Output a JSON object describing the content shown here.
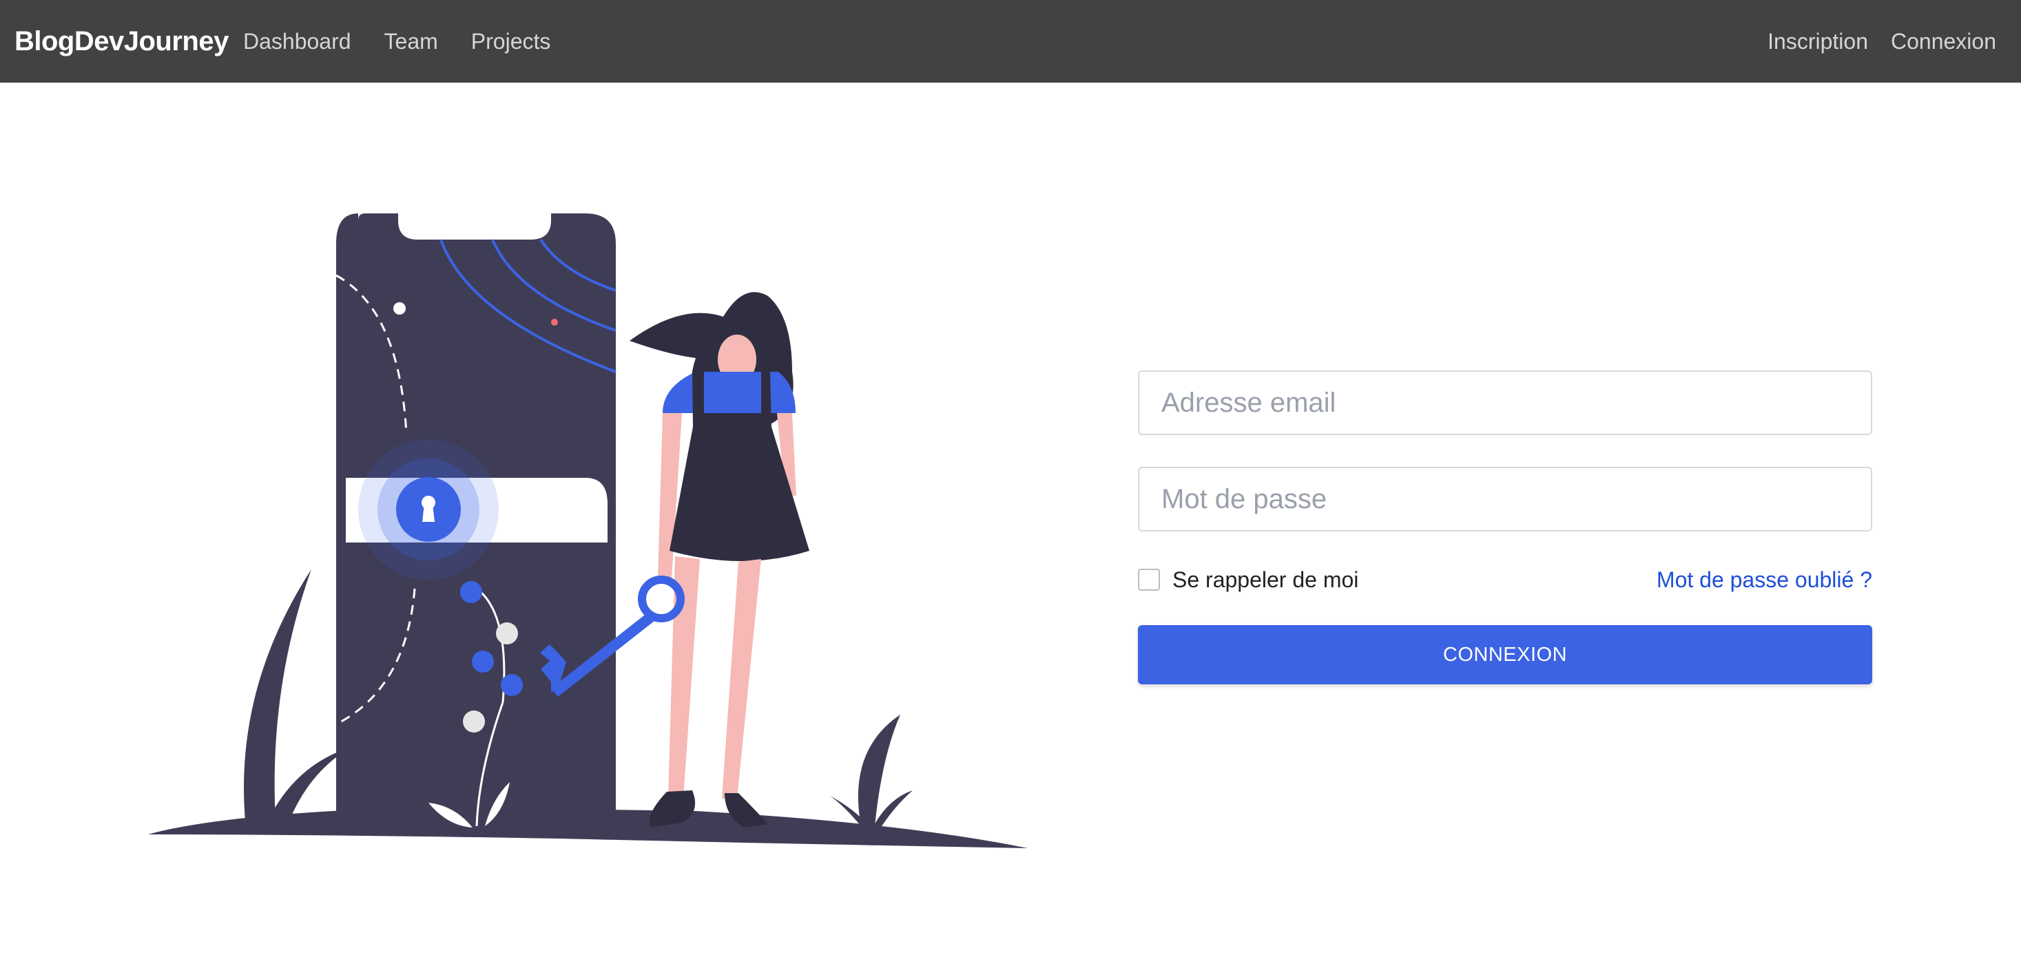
{
  "navbar": {
    "brand": "BlogDevJourney",
    "left_links": [
      "Dashboard",
      "Team",
      "Projects"
    ],
    "right_links": [
      "Inscription",
      "Connexion"
    ]
  },
  "login": {
    "email_placeholder": "Adresse email",
    "password_placeholder": "Mot de passe",
    "remember_label": "Se rappeler de moi",
    "remember_checked": false,
    "forgot_link": "Mot de passe oublié ?",
    "submit_label": "CONNEXION"
  },
  "colors": {
    "navbar_bg": "#424242",
    "accent": "#3b63e3",
    "illustration_dark": "#3f3d56",
    "illustration_skin": "#f6b9b5"
  },
  "illustration": {
    "icon": "phone-lock-woman-with-key-illustration"
  }
}
